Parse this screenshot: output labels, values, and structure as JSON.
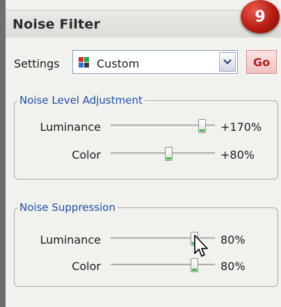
{
  "header": {
    "title": "Noise Filter",
    "step_badge": "9"
  },
  "settings": {
    "label": "Settings",
    "selected": "Custom",
    "icon": "custom-preset-icon",
    "go_label": "Go"
  },
  "noise_level": {
    "title": "Noise Level Adjustment",
    "luminance": {
      "label": "Luminance",
      "value": "+170%",
      "fraction": 0.87
    },
    "color": {
      "label": "Color",
      "value": "+80%",
      "fraction": 0.55
    }
  },
  "suppression": {
    "title": "Noise Suppression",
    "luminance": {
      "label": "Luminance",
      "value": "80%",
      "fraction": 0.8
    },
    "color": {
      "label": "Color",
      "value": "80%",
      "fraction": 0.8
    }
  },
  "colors": {
    "badge": "#b51d12",
    "group_title": "#1f4ea8",
    "go_text": "#b02020",
    "thumb_accent": "#36b24a"
  }
}
